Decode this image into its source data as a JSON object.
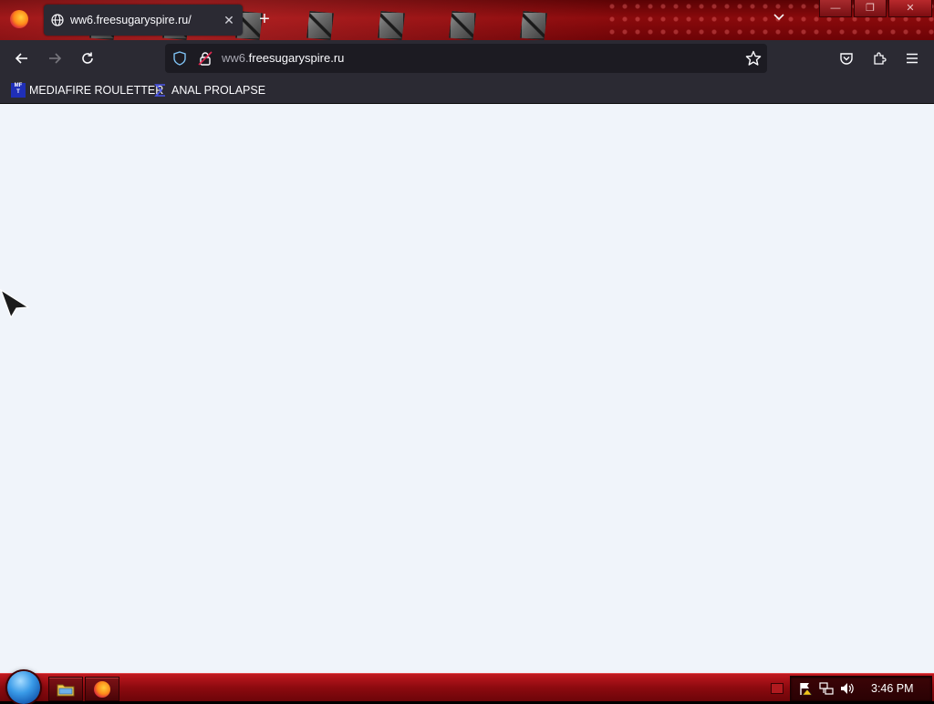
{
  "window": {
    "controls": {
      "minimize": "—",
      "restore": "❐",
      "close": "✕"
    }
  },
  "tabs": [
    {
      "title": "ww6.freesugaryspire.ru/",
      "icon": "globe-icon",
      "close_label": "✕"
    }
  ],
  "tabstrip": {
    "new_tab_label": "+",
    "tablist_icon": "chevron-down-icon"
  },
  "navbar": {
    "back_icon": "back-arrow-icon",
    "forward_icon": "forward-arrow-icon",
    "reload_icon": "reload-icon",
    "url": {
      "subdomain": "ww6.",
      "domain": "freesugaryspire.ru"
    },
    "right_icons": [
      "pocket-icon",
      "extensions-icon",
      "menu-icon"
    ]
  },
  "bookmarks": [
    {
      "label": "MEDIAFIRE ROULETTER",
      "icon_text": "MF\nT"
    },
    {
      "label": "ANAL PROLAPSE",
      "icon": "sigma-icon"
    }
  ],
  "taskbar": {
    "pinned": [
      "file-explorer-icon",
      "firefox-icon"
    ],
    "clock": "3:46 PM"
  },
  "colors": {
    "chrome_dark": "#2b2a33",
    "url_field": "#1c1b22",
    "page_bg": "#f0f4fa",
    "taskbar_red": "#8c0a0f",
    "tab_strip_red": "#8a0a0c",
    "shield_blue": "#7fc3f5"
  }
}
